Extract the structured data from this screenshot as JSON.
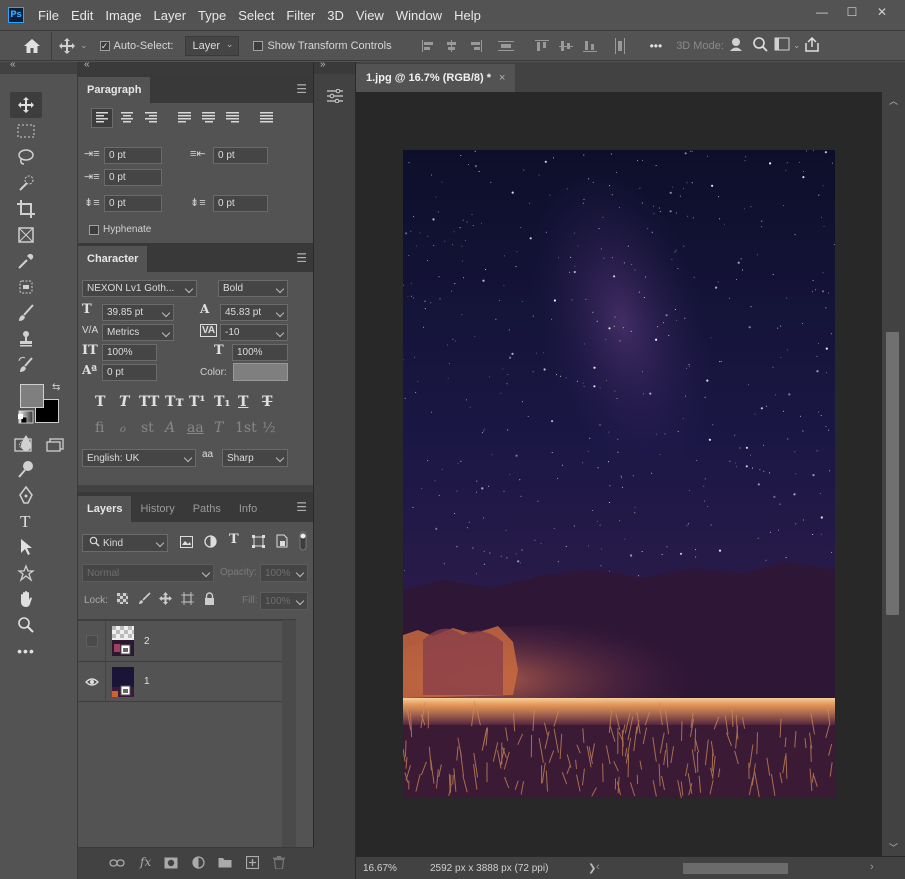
{
  "app": {
    "logo": "Ps"
  },
  "menu": [
    "File",
    "Edit",
    "Image",
    "Layer",
    "Type",
    "Select",
    "Filter",
    "3D",
    "View",
    "Window",
    "Help"
  ],
  "window_controls": {
    "minimize": "—",
    "maximize": "☐",
    "close": "✕"
  },
  "options": {
    "auto_select_label": "Auto-Select:",
    "auto_select_value": "Layer",
    "transform_label": "Show Transform Controls",
    "mode_3d_label": "3D Mode:",
    "more": "•••"
  },
  "paragraph": {
    "tab": "Paragraph",
    "indent_left": "0 pt",
    "indent_right": "0 pt",
    "indent_first": "0 pt",
    "space_before": "0 pt",
    "space_after": "0 pt",
    "hyphenate_label": "Hyphenate"
  },
  "character": {
    "tab": "Character",
    "font_family": "NEXON Lv1 Goth...",
    "font_style": "Bold",
    "font_size": "39.85 pt",
    "leading": "45.83 pt",
    "kerning": "Metrics",
    "tracking": "-10",
    "vscale": "100%",
    "hscale": "100%",
    "baseline": "0 pt",
    "color_label": "Color:",
    "color_value": "#7f7f7f",
    "language": "English: UK",
    "antialias_icon": "aa",
    "antialias": "Sharp",
    "style_buttons": [
      "T",
      "T",
      "TT",
      "Tт",
      "T¹",
      "T₁",
      "T",
      "T"
    ],
    "opentype_buttons": [
      "fi",
      "ℴ",
      "st",
      "A",
      "aa",
      "T",
      "1st",
      "½"
    ]
  },
  "layers": {
    "tabs": [
      "Layers",
      "History",
      "Paths",
      "Info"
    ],
    "filter_kind": "Kind",
    "blend_mode": "Normal",
    "opacity_label": "Opacity:",
    "opacity_value": "100%",
    "lock_label": "Lock:",
    "fill_label": "Fill:",
    "fill_value": "100%",
    "items": [
      {
        "name": "2",
        "visible": false
      },
      {
        "name": "1",
        "visible": true
      }
    ],
    "footer_fx": "fx"
  },
  "document": {
    "tab_title": "1.jpg @ 16.7% (RGB/8) *",
    "tab_close": "×",
    "zoom": "16.67%",
    "info": "2592 px x 3888 px (72 ppi)",
    "status_arrow": "❯"
  },
  "colors": {
    "accent": "#31a8ff",
    "foreground": "#7f7f7f",
    "background": "#000000"
  }
}
